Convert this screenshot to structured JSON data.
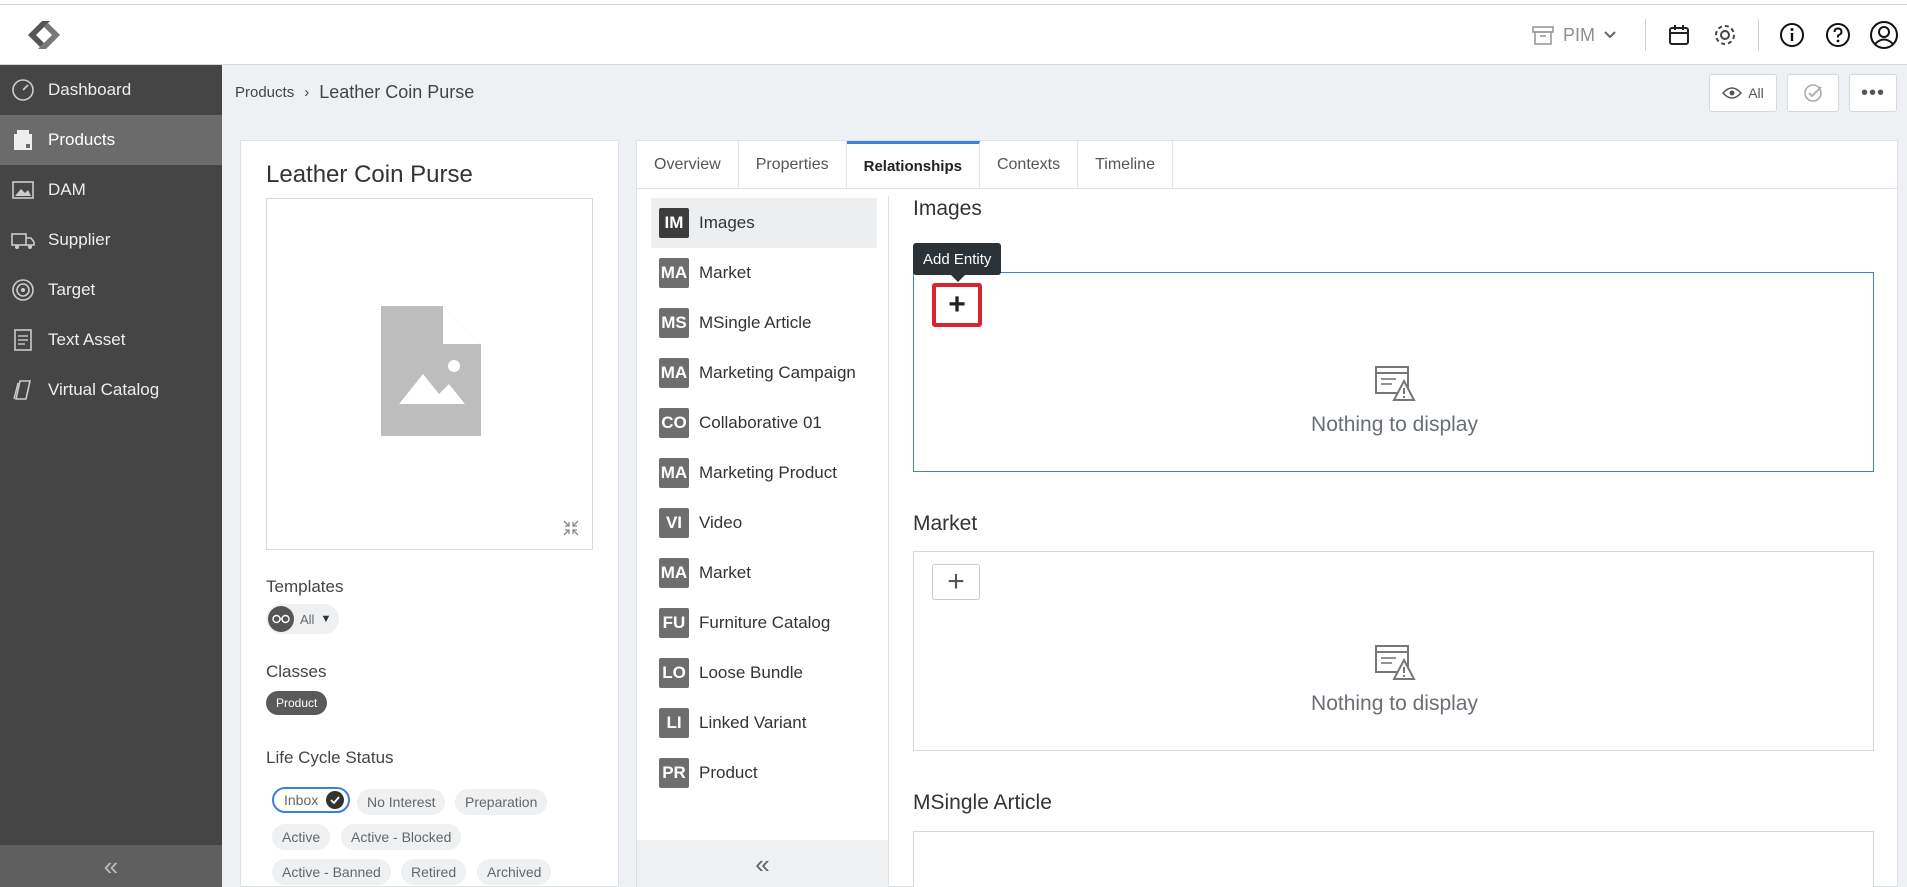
{
  "header": {
    "module": "PIM",
    "icons": [
      "calendar-icon",
      "gear-icon",
      "info-icon",
      "help-icon",
      "user-avatar-icon"
    ]
  },
  "sidebar": {
    "items": [
      {
        "label": "Dashboard",
        "icon": "dashboard-icon"
      },
      {
        "label": "Products",
        "icon": "products-icon",
        "active": true
      },
      {
        "label": "DAM",
        "icon": "image-icon"
      },
      {
        "label": "Supplier",
        "icon": "truck-icon"
      },
      {
        "label": "Target",
        "icon": "target-icon"
      },
      {
        "label": "Text Asset",
        "icon": "document-icon"
      },
      {
        "label": "Virtual Catalog",
        "icon": "catalog-icon"
      }
    ]
  },
  "breadcrumb": {
    "parent": "Products",
    "separator": "›",
    "current": "Leather Coin Purse"
  },
  "toolbar": {
    "view_label": "All"
  },
  "product": {
    "title": "Leather Coin Purse",
    "templates_label": "Templates",
    "templates_value": "All",
    "classes_label": "Classes",
    "class_value": "Product",
    "lifecycle_label": "Life Cycle Status",
    "lifecycle": [
      "Inbox",
      "No Interest",
      "Preparation",
      "Active",
      "Active - Blocked",
      "Active - Banned",
      "Retired",
      "Archived"
    ]
  },
  "tabs": [
    "Overview",
    "Properties",
    "Relationships",
    "Contexts",
    "Timeline"
  ],
  "active_tab": "Relationships",
  "relationships": [
    {
      "code": "IM",
      "label": "Images"
    },
    {
      "code": "MA",
      "label": "Market"
    },
    {
      "code": "MS",
      "label": "MSingle Article"
    },
    {
      "code": "MA",
      "label": "Marketing Campaign"
    },
    {
      "code": "CO",
      "label": "Collaborative 01"
    },
    {
      "code": "MA",
      "label": "Marketing Product"
    },
    {
      "code": "VI",
      "label": "Video"
    },
    {
      "code": "MA",
      "label": "Market"
    },
    {
      "code": "FU",
      "label": "Furniture Catalog"
    },
    {
      "code": "LO",
      "label": "Loose Bundle"
    },
    {
      "code": "LI",
      "label": "Linked Variant"
    },
    {
      "code": "PR",
      "label": "Product"
    }
  ],
  "sections": [
    {
      "title": "Images",
      "empty": "Nothing to display"
    },
    {
      "title": "Market",
      "empty": "Nothing to display"
    },
    {
      "title": "MSingle Article",
      "empty": ""
    }
  ],
  "tooltip": "Add Entity",
  "colors": {
    "accent": "#3b82d4",
    "highlight": "#d9232e",
    "sidebar": "#454545"
  }
}
